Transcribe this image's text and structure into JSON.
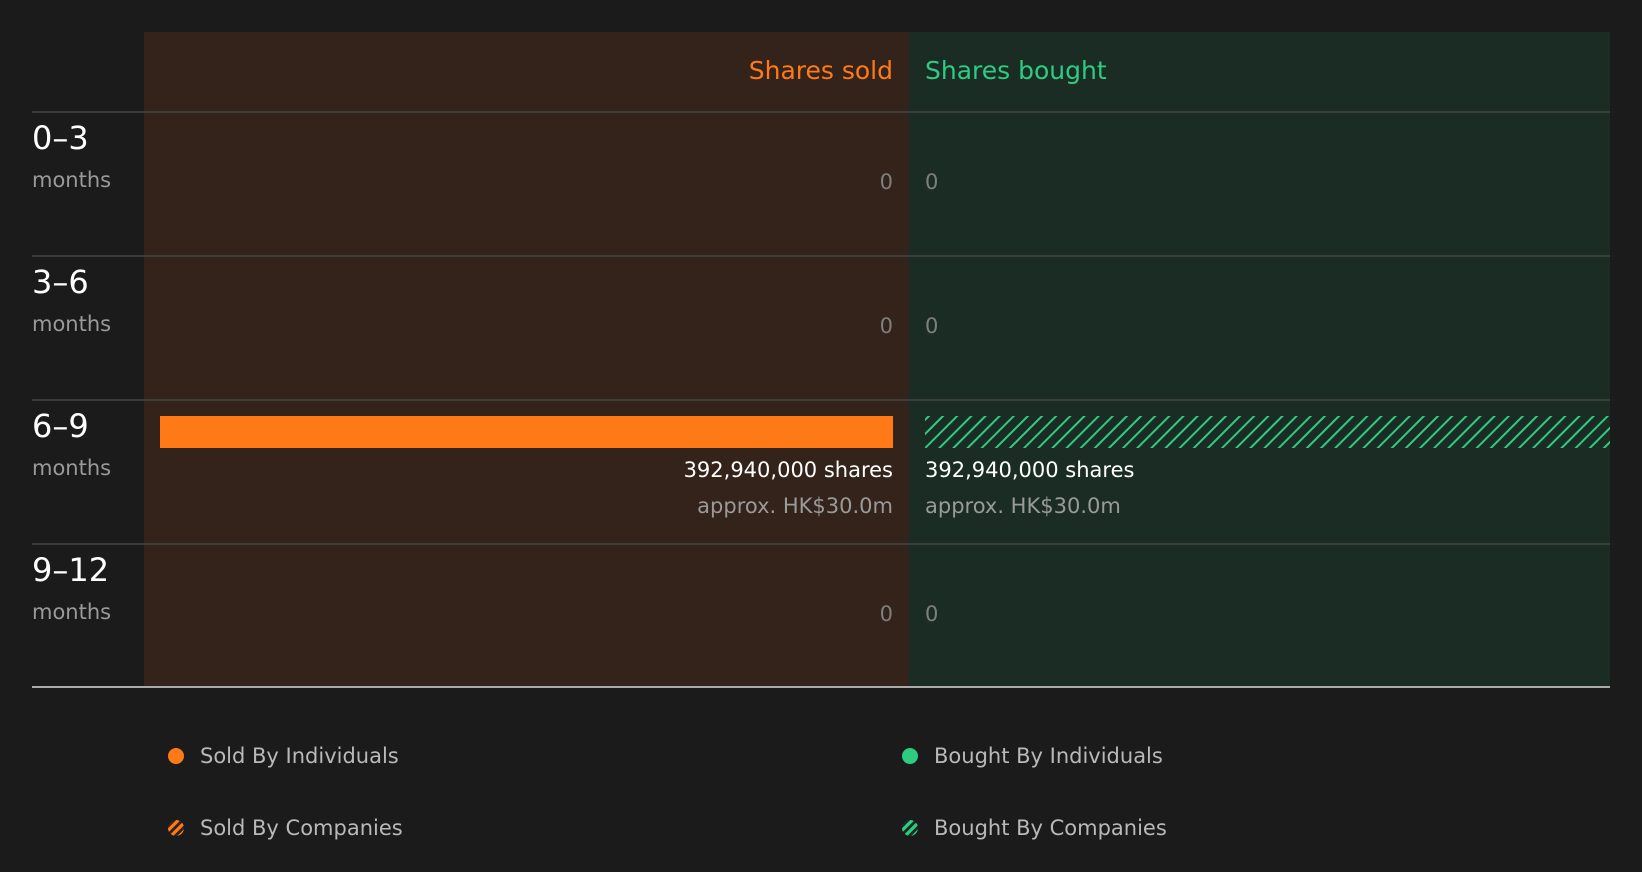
{
  "colors": {
    "page_bg": "#1b1b1b",
    "sold_panel_bg": "#33231b",
    "bought_panel_bg": "#1b2c25",
    "sold_accent": "#ff7a17",
    "bought_accent": "#2ecc80",
    "text_primary": "#ffffff",
    "text_secondary": "#9a9a9a",
    "zero_label": "#7f7f7f",
    "divider": "#444444",
    "baseline": "#aaaaaa"
  },
  "chart_data": {
    "type": "bar",
    "orientation": "horizontal-diverging",
    "grid": false,
    "headers": {
      "sold": "Shares sold",
      "bought": "Shares bought"
    },
    "periods": [
      {
        "range": "0–3",
        "unit": "months",
        "sold": {
          "shares": 0,
          "label": "0",
          "approx": "",
          "by": null
        },
        "bought": {
          "shares": 0,
          "label": "0",
          "approx": "",
          "by": null
        }
      },
      {
        "range": "3–6",
        "unit": "months",
        "sold": {
          "shares": 0,
          "label": "0",
          "approx": "",
          "by": null
        },
        "bought": {
          "shares": 0,
          "label": "0",
          "approx": "",
          "by": null
        }
      },
      {
        "range": "6–9",
        "unit": "months",
        "sold": {
          "shares": 392940000,
          "label": "392,940,000 shares",
          "approx": "approx. HK$30.0m",
          "by": "individuals"
        },
        "bought": {
          "shares": 392940000,
          "label": "392,940,000 shares",
          "approx": "approx. HK$30.0m",
          "by": "companies"
        }
      },
      {
        "range": "9–12",
        "unit": "months",
        "sold": {
          "shares": 0,
          "label": "0",
          "approx": "",
          "by": null
        },
        "bought": {
          "shares": 0,
          "label": "0",
          "approx": "",
          "by": null
        }
      }
    ],
    "max_shares": 392940000,
    "legend": [
      {
        "label": "Sold By Individuals",
        "side": "sold",
        "style": "solid"
      },
      {
        "label": "Bought By Individuals",
        "side": "bought",
        "style": "solid"
      },
      {
        "label": "Sold By Companies",
        "side": "sold",
        "style": "hatched"
      },
      {
        "label": "Bought By Companies",
        "side": "bought",
        "style": "hatched"
      }
    ]
  }
}
